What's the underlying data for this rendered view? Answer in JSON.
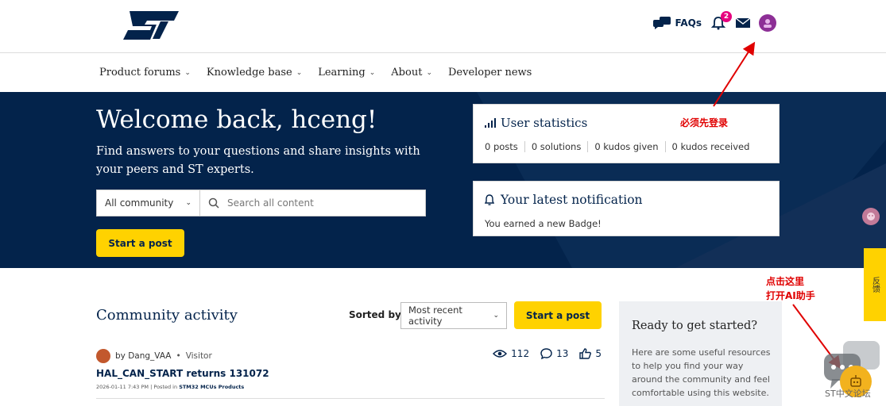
{
  "header": {
    "logo_text": "ST",
    "faqs_label": "FAQs",
    "notification_count": "2"
  },
  "nav": {
    "items": [
      {
        "label": "Product forums"
      },
      {
        "label": "Knowledge base"
      },
      {
        "label": "Learning"
      },
      {
        "label": "About"
      },
      {
        "label": "Developer news"
      }
    ]
  },
  "hero": {
    "welcome": "Welcome back, hceng!",
    "subtitle": "Find answers to your questions and share insights with your peers and ST experts.",
    "scope_value": "All community",
    "search_placeholder": "Search all content",
    "start_post": "Start a post"
  },
  "user_stats": {
    "title": "User statistics",
    "items": [
      "0 posts",
      "0 solutions",
      "0 kudos given",
      "0 kudos received"
    ]
  },
  "notification": {
    "title": "Your latest notification",
    "text": "You earned a new Badge!"
  },
  "annotations": {
    "login": "必须先登录",
    "ai_line1": "点击这里",
    "ai_line2": "打开AI助手"
  },
  "community": {
    "title": "Community activity",
    "sorted_by_label": "Sorted by:",
    "sort_value": "Most recent activity",
    "start_post": "Start a post",
    "posts": [
      {
        "author": "by Dang_VAA",
        "separator": "•",
        "role": "Visitor",
        "title": "HAL_CAN_START returns 131072",
        "date": "2026-01-11 7:43 PM",
        "posted_in_label": "Posted in",
        "board": "STM32 MCUs Products",
        "views": "112",
        "replies": "13",
        "kudos": "5"
      }
    ]
  },
  "ready": {
    "title": "Ready to get started?",
    "text": "Here are some useful resources to help you find your way around the community and feel comfortable using this website."
  },
  "side_tab": {
    "label": "反馈"
  },
  "watermark": {
    "text": "ST中文论坛"
  },
  "colors": {
    "navy": "#03234b",
    "yellow": "#ffd200",
    "annotation_red": "#e00000",
    "badge_pink": "#e6007e"
  }
}
